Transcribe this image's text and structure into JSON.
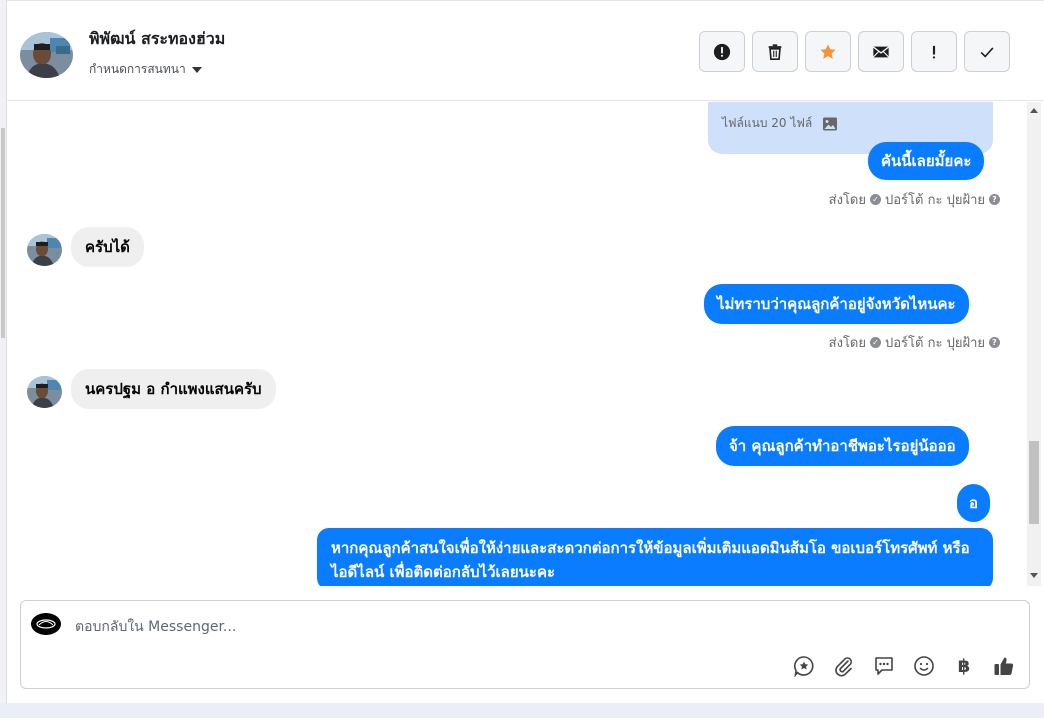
{
  "header": {
    "name": "พิพัฒน์ สระทองฮ่วม",
    "assign_label": "กำหนดการสนทนา",
    "actions": [
      {
        "icon": "alert-circle-icon",
        "name": "mark-spam-button"
      },
      {
        "icon": "trash-icon",
        "name": "delete-button"
      },
      {
        "icon": "star-icon",
        "name": "star-button"
      },
      {
        "icon": "envelope-icon",
        "name": "mark-unread-button"
      },
      {
        "icon": "exclamation-icon",
        "name": "follow-up-button"
      },
      {
        "icon": "check-icon",
        "name": "mark-done-button"
      }
    ],
    "colors": {
      "star": "#f7923b"
    }
  },
  "conversation": {
    "attachment_label": "ไฟล์แนบ 20 ไฟล์",
    "messages": [
      {
        "dir": "out",
        "text": "คันนี้เลยมั้ยคะ"
      },
      {
        "dir": "in",
        "text": "ครับได้"
      },
      {
        "dir": "out",
        "text": "ไม่ทราบว่าคุณลูกค้าอยู่จังหวัดไหนคะ"
      },
      {
        "dir": "in",
        "text": "นครปฐม อ  กำแพงแสนครับ"
      },
      {
        "dir": "out",
        "text": "จ้า คุณลูกค้าทำอาชีพอะไรอยู่น้อออ"
      },
      {
        "dir": "out",
        "text": "อ"
      },
      {
        "dir": "out",
        "text": "หากคุณลูกค้าสนใจเพื่อให้ง่ายและสะดวกต่อการให้ข้อมูลเพิ่มเติมแอดมินส้มโอ ขอเบอร์โทรศัพท์ หรือ ไอดีไลน์ เพื่อติดต่อกลับไว้เลยนะคะ"
      }
    ],
    "sent_by": {
      "prefix": "ส่งโดย",
      "agent": "ปอร์โต้ กะ ปุยฝ้าย"
    },
    "colors": {
      "outgoing": "#0a7cff",
      "incoming": "#efefef",
      "attachment_bg": "#cfe0fb"
    }
  },
  "composer": {
    "placeholder": "ตอบกลับใน Messenger...",
    "tools": [
      {
        "icon": "saved-reply-icon"
      },
      {
        "icon": "paperclip-icon"
      },
      {
        "icon": "quick-reply-icon"
      },
      {
        "icon": "emoji-icon"
      },
      {
        "icon": "baht-icon",
        "glyph": "฿"
      },
      {
        "icon": "thumbs-up-icon"
      }
    ]
  }
}
